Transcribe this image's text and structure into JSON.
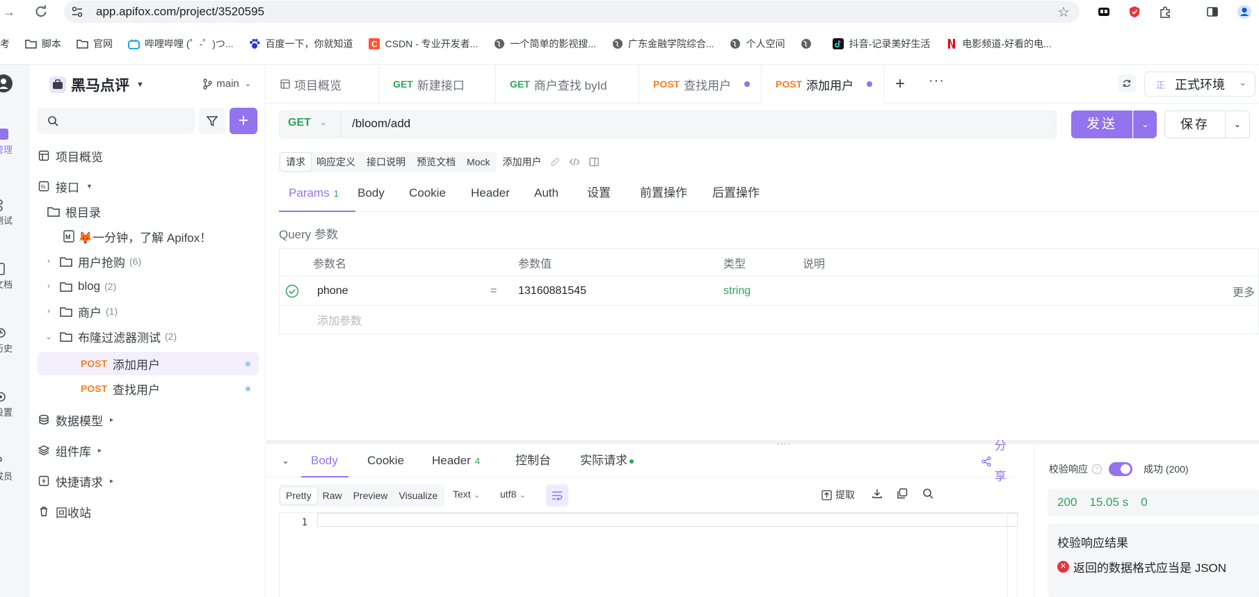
{
  "browser": {
    "url": "app.apifox.com/project/3520595",
    "bookmarks": [
      {
        "label": "备考",
        "icon": "folder-icon"
      },
      {
        "label": "脚本",
        "icon": "folder-icon"
      },
      {
        "label": "官网",
        "icon": "folder-icon"
      },
      {
        "label": "哔哩哔哩 (゜-゜)つ...",
        "icon": "bilibili-icon"
      },
      {
        "label": "百度一下，你就知道",
        "icon": "baidu-icon"
      },
      {
        "label": "CSDN - 专业开发者...",
        "icon": "csdn-icon"
      },
      {
        "label": "一个简单的影视搜...",
        "icon": "globe-icon"
      },
      {
        "label": "广东金融学院综合...",
        "icon": "globe-icon"
      },
      {
        "label": "个人空间",
        "icon": "globe-icon"
      },
      {
        "label": "",
        "icon": "globe-icon"
      },
      {
        "label": "抖音-记录美好生活",
        "icon": "douyin-icon"
      },
      {
        "label": "电影频道-好看的电...",
        "icon": "netflix-icon"
      }
    ]
  },
  "rail": {
    "items": [
      {
        "label": "管理",
        "icon": "interface-icon"
      },
      {
        "label": "测试",
        "icon": "test-icon"
      },
      {
        "label": "文档",
        "icon": "doc-icon"
      },
      {
        "label": "历史",
        "icon": "history-icon"
      },
      {
        "label": "设置",
        "icon": "settings-icon"
      },
      {
        "label": "成员",
        "icon": "member-icon"
      }
    ]
  },
  "sidebar": {
    "project_name": "黑马点评",
    "branch": "main",
    "search_placeholder": "",
    "tree": {
      "overview": "项目概览",
      "interfaces": "接口",
      "root": "根目录",
      "intro": "🦊一分钟，了解 Apifox！",
      "folders": [
        {
          "name": "用户抢购",
          "count": "(6)"
        },
        {
          "name": "blog",
          "count": "(2)"
        },
        {
          "name": "商户",
          "count": "(1)"
        },
        {
          "name": "布隆过滤器测试",
          "count": "(2)"
        }
      ],
      "endpoints": [
        {
          "method": "POST",
          "name": "添加用户"
        },
        {
          "method": "POST",
          "name": "查找用户"
        }
      ],
      "data_model": "数据模型",
      "components": "组件库",
      "quick_request": "快捷请求",
      "recycle": "回收站"
    }
  },
  "tabs": [
    {
      "method": "",
      "label": "项目概览"
    },
    {
      "method": "GET",
      "label": "新建接口"
    },
    {
      "method": "GET",
      "label": "商户查找 byId"
    },
    {
      "method": "POST",
      "label": "查找用户"
    },
    {
      "method": "POST",
      "label": "添加用户"
    }
  ],
  "environment": {
    "badge": "正",
    "name": "正式环境"
  },
  "request": {
    "method": "GET",
    "url": "/bloom/add",
    "send_label": "发送",
    "save_label": "保存",
    "subtabs": [
      "请求",
      "响应定义",
      "接口说明",
      "预览文档",
      "Mock"
    ],
    "name": "添加用户"
  },
  "param_tabs": [
    {
      "label": "Params",
      "count": "1"
    },
    {
      "label": "Body",
      "count": ""
    },
    {
      "label": "Cookie",
      "count": ""
    },
    {
      "label": "Header",
      "count": ""
    },
    {
      "label": "Auth",
      "count": ""
    },
    {
      "label": "设置",
      "count": ""
    },
    {
      "label": "前置操作",
      "count": ""
    },
    {
      "label": "后置操作",
      "count": ""
    }
  ],
  "query": {
    "title": "Query 参数",
    "headers": {
      "name": "参数名",
      "value": "参数值",
      "type": "类型",
      "desc": "说明"
    },
    "rows": [
      {
        "name": "phone",
        "eq": "=",
        "value": "13160881545",
        "type": "string",
        "more": "更多"
      }
    ],
    "add_placeholder": "添加参数"
  },
  "response": {
    "tabs": [
      {
        "label": "Body",
        "count": ""
      },
      {
        "label": "Cookie",
        "count": ""
      },
      {
        "label": "Header",
        "count": "4"
      },
      {
        "label": "控制台",
        "count": ""
      },
      {
        "label": "实际请求",
        "count": ""
      }
    ],
    "share": "分享",
    "formats": [
      "Pretty",
      "Raw",
      "Preview",
      "Visualize"
    ],
    "text_select": "Text",
    "encoding_select": "utf8",
    "extract": "提取",
    "line_number": "1"
  },
  "validation": {
    "label": "校验响应",
    "status_text": "成功 (200)",
    "status_code": "200",
    "time": "15.05 s",
    "size": "0",
    "result_title": "校验响应结果",
    "error_text": "返回的数据格式应当是 JSON"
  },
  "colors": {
    "accent": "#9373ee",
    "get": "#2ea35a",
    "post": "#f77f24",
    "error": "#e8343a"
  }
}
